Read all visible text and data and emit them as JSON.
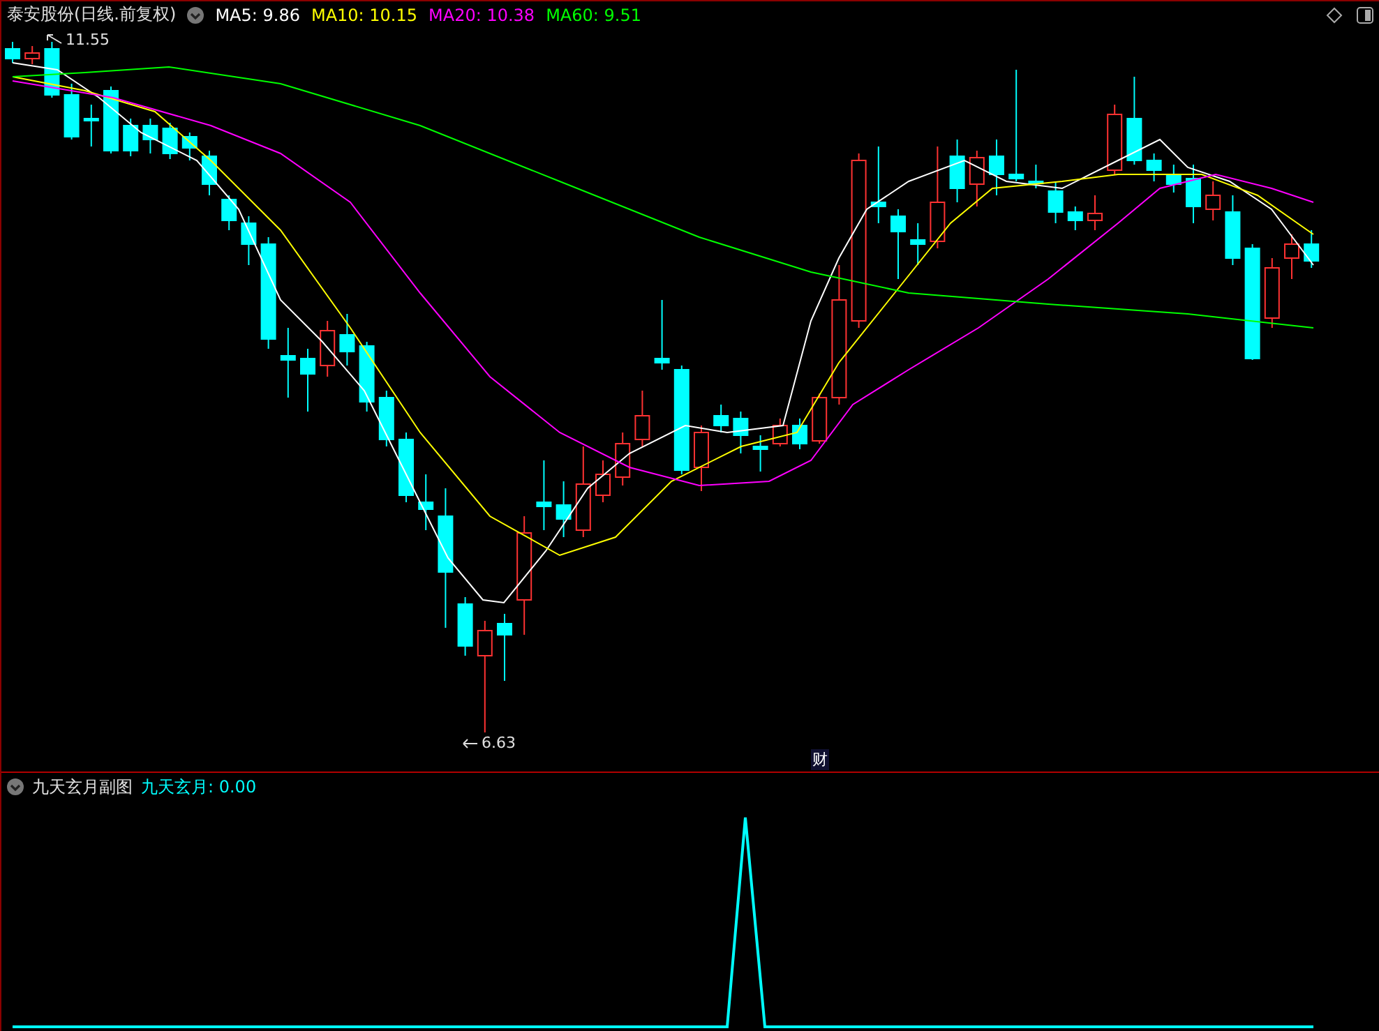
{
  "header": {
    "title": "泰安股份(日线.前复权)",
    "indicators": [
      {
        "label": "MA5: 9.86",
        "color": "#ffffff"
      },
      {
        "label": "MA10: 10.15",
        "color": "#ffff00"
      },
      {
        "label": "MA20: 10.38",
        "color": "#ff00ff"
      },
      {
        "label": "MA60: 9.51",
        "color": "#00ff00"
      }
    ]
  },
  "main_chart": {
    "high_label": "11.55",
    "low_label": "6.63",
    "marker": "财"
  },
  "sub_panel": {
    "title": "九天玄月副图",
    "indicator": {
      "label": "九天玄月: 0.00",
      "color": "#00ffff"
    }
  }
}
